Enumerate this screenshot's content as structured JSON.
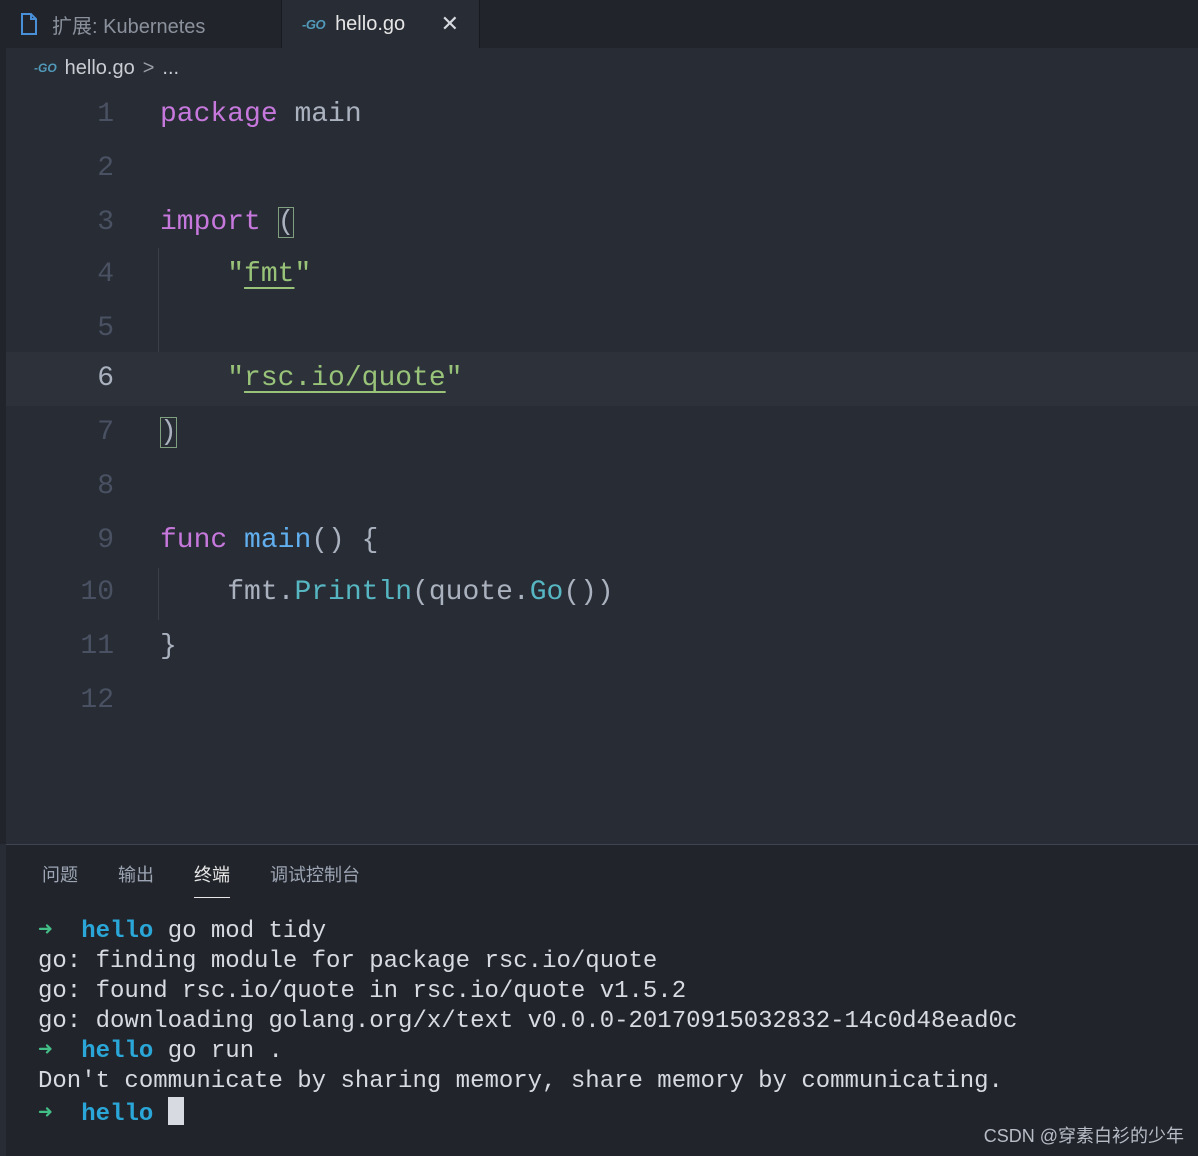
{
  "tabs": [
    {
      "label": "扩展: Kubernetes",
      "icon": "file-icon",
      "active": false
    },
    {
      "label": "hello.go",
      "icon": "go-file-icon",
      "active": true,
      "close": "✕"
    }
  ],
  "breadcrumb": {
    "file": "hello.go",
    "separator": ">",
    "rest": "..."
  },
  "editor": {
    "current_line": 6,
    "lines": [
      {
        "n": "1"
      },
      {
        "n": "2"
      },
      {
        "n": "3"
      },
      {
        "n": "4"
      },
      {
        "n": "5"
      },
      {
        "n": "6"
      },
      {
        "n": "7"
      },
      {
        "n": "8"
      },
      {
        "n": "9"
      },
      {
        "n": "10"
      },
      {
        "n": "11"
      },
      {
        "n": "12"
      }
    ],
    "tokens": {
      "package": "package",
      "main_pkg": "main",
      "import": "import",
      "paren_open": "(",
      "paren_close": ")",
      "quote": "\"",
      "fmt": "fmt",
      "quote_pkg": "rsc.io/quote",
      "func": "func",
      "main_fn": "main",
      "fn_parens": "()",
      "brace_open": "{",
      "fmt_call": "fmt.",
      "println": "Println",
      "paren": "(",
      "quote_call": "quote.",
      "go": "Go",
      "close_call": "())",
      "brace_close": "}"
    }
  },
  "panel": {
    "tabs": [
      "问题",
      "输出",
      "终端",
      "调试控制台"
    ],
    "active_tab": "终端"
  },
  "terminal": {
    "prompt_arrow": "➜",
    "dir": "hello",
    "lines": [
      {
        "type": "prompt",
        "cmd": "go mod tidy"
      },
      {
        "type": "out",
        "text": "go: finding module for package rsc.io/quote"
      },
      {
        "type": "out",
        "text": "go: found rsc.io/quote in rsc.io/quote v1.5.2"
      },
      {
        "type": "out",
        "text": "go: downloading golang.org/x/text v0.0.0-20170915032832-14c0d48ead0c"
      },
      {
        "type": "prompt",
        "cmd": "go run ."
      },
      {
        "type": "out",
        "text": "Don't communicate by sharing memory, share memory by communicating."
      },
      {
        "type": "prompt",
        "cmd": ""
      }
    ]
  },
  "watermark": "CSDN @穿素白衫的少年",
  "colors": {
    "background": "#282c34",
    "keyword": "#c678dd",
    "string": "#98c379",
    "function": "#61afef",
    "method": "#56b6c2",
    "prompt_arrow": "#42be86",
    "prompt_dir": "#2aa7d8"
  }
}
